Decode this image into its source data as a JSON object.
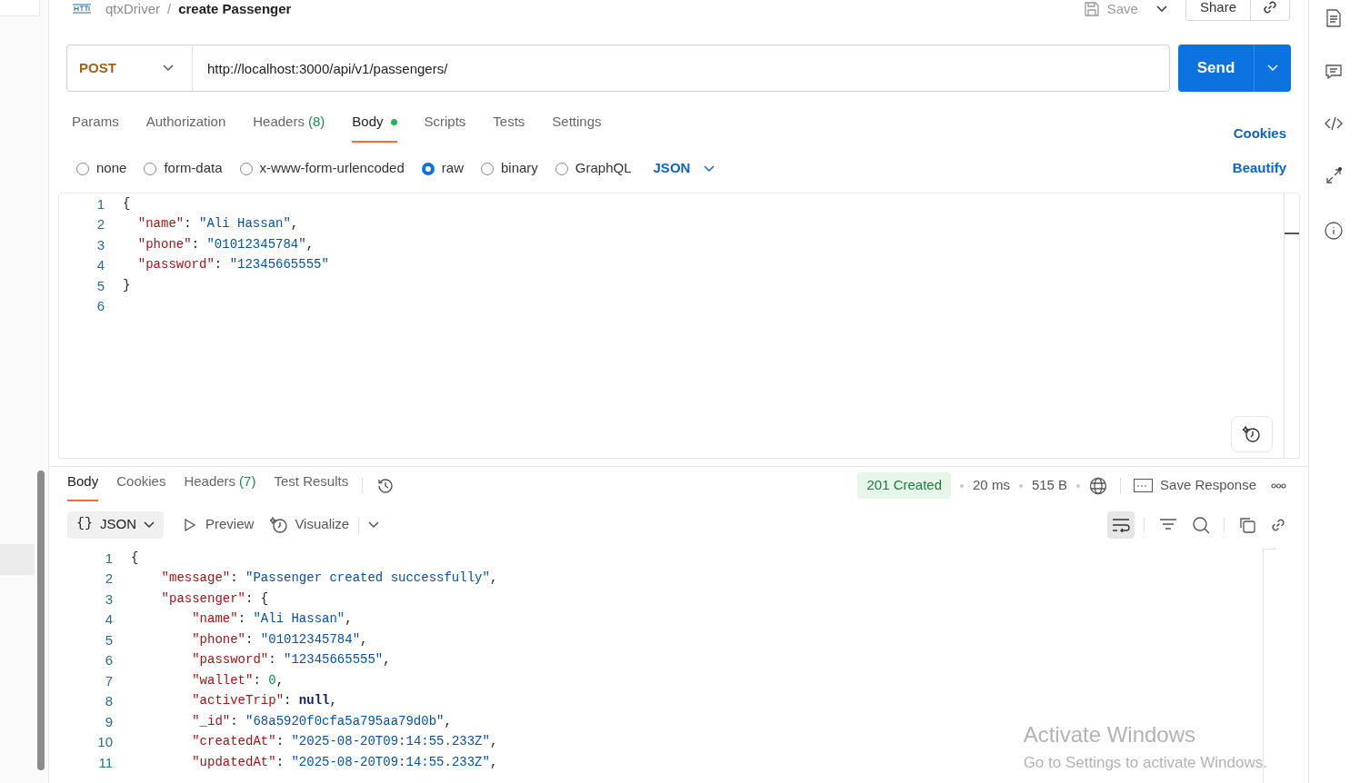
{
  "breadcrumb": {
    "collection": "qtxDriver",
    "separator": "/",
    "request": "create Passenger"
  },
  "header_actions": {
    "save": "Save",
    "share": "Share"
  },
  "request": {
    "method": "POST",
    "url": "http://localhost:3000/api/v1/passengers/",
    "send": "Send"
  },
  "request_tabs": [
    {
      "label": "Params",
      "selected": false,
      "dot": false
    },
    {
      "label": "Authorization",
      "selected": false,
      "dot": false
    },
    {
      "label": "Headers",
      "count": "(8)",
      "selected": false,
      "dot": false
    },
    {
      "label": "Body",
      "selected": true,
      "dot": true
    },
    {
      "label": "Scripts",
      "selected": false,
      "dot": false
    },
    {
      "label": "Tests",
      "selected": false,
      "dot": false
    },
    {
      "label": "Settings",
      "selected": false,
      "dot": false
    }
  ],
  "cookies_link": "Cookies",
  "body_types": [
    {
      "label": "none",
      "selected": false
    },
    {
      "label": "form-data",
      "selected": false
    },
    {
      "label": "x-www-form-urlencoded",
      "selected": false
    },
    {
      "label": "raw",
      "selected": true
    },
    {
      "label": "binary",
      "selected": false
    },
    {
      "label": "GraphQL",
      "selected": false
    }
  ],
  "raw_format": "JSON",
  "beautify": "Beautify",
  "request_body": [
    {
      "number": "1",
      "tokens": [
        {
          "kind": "punct",
          "text": "{"
        }
      ]
    },
    {
      "number": "2",
      "tokens": [
        {
          "kind": "key",
          "text": "  \"name\""
        },
        {
          "kind": "punct",
          "text": ": "
        },
        {
          "kind": "str",
          "text": "\"Ali Hassan\""
        },
        {
          "kind": "punct",
          "text": ","
        }
      ]
    },
    {
      "number": "3",
      "tokens": [
        {
          "kind": "key",
          "text": "  \"phone\""
        },
        {
          "kind": "punct",
          "text": ": "
        },
        {
          "kind": "str",
          "text": "\"01012345784\""
        },
        {
          "kind": "punct",
          "text": ","
        }
      ]
    },
    {
      "number": "4",
      "tokens": [
        {
          "kind": "key",
          "text": "  \"password\""
        },
        {
          "kind": "punct",
          "text": ": "
        },
        {
          "kind": "str",
          "text": "\"12345665555\""
        }
      ]
    },
    {
      "number": "5",
      "tokens": [
        {
          "kind": "punct",
          "text": "}"
        }
      ]
    },
    {
      "number": "6"
    }
  ],
  "response_tabs": [
    {
      "label": "Body",
      "selected": true
    },
    {
      "label": "Cookies",
      "selected": false
    },
    {
      "label": "Headers",
      "count": "(7)",
      "selected": false
    },
    {
      "label": "Test Results",
      "selected": false
    }
  ],
  "response_meta": {
    "status": "201 Created",
    "time": "20 ms",
    "size": "515 B",
    "save_response": "Save Response"
  },
  "response_views": {
    "format_icon": "{}",
    "format": "JSON",
    "preview": "Preview",
    "visualize": "Visualize"
  },
  "response_body": [
    {
      "number": "1",
      "tokens": [
        {
          "kind": "punct",
          "text": "{"
        }
      ]
    },
    {
      "number": "2",
      "tokens": [
        {
          "kind": "key",
          "text": "    \"message\""
        },
        {
          "kind": "punct",
          "text": ": "
        },
        {
          "kind": "str",
          "text": "\"Passenger created successfully\""
        },
        {
          "kind": "punct",
          "text": ","
        }
      ]
    },
    {
      "number": "3",
      "tokens": [
        {
          "kind": "key",
          "text": "    \"passenger\""
        },
        {
          "kind": "punct",
          "text": ": {"
        }
      ]
    },
    {
      "number": "4",
      "tokens": [
        {
          "kind": "key",
          "text": "        \"name\""
        },
        {
          "kind": "punct",
          "text": ": "
        },
        {
          "kind": "str",
          "text": "\"Ali Hassan\""
        },
        {
          "kind": "punct",
          "text": ","
        }
      ]
    },
    {
      "number": "5",
      "tokens": [
        {
          "kind": "key",
          "text": "        \"phone\""
        },
        {
          "kind": "punct",
          "text": ": "
        },
        {
          "kind": "str",
          "text": "\"01012345784\""
        },
        {
          "kind": "punct",
          "text": ","
        }
      ]
    },
    {
      "number": "6",
      "tokens": [
        {
          "kind": "key",
          "text": "        \"password\""
        },
        {
          "kind": "punct",
          "text": ": "
        },
        {
          "kind": "str",
          "text": "\"12345665555\""
        },
        {
          "kind": "punct",
          "text": ","
        }
      ]
    },
    {
      "number": "7",
      "tokens": [
        {
          "kind": "key",
          "text": "        \"wallet\""
        },
        {
          "kind": "punct",
          "text": ": "
        },
        {
          "kind": "num",
          "text": "0"
        },
        {
          "kind": "punct",
          "text": ","
        }
      ]
    },
    {
      "number": "8",
      "tokens": [
        {
          "kind": "key",
          "text": "        \"activeTrip\""
        },
        {
          "kind": "punct",
          "text": ": "
        },
        {
          "kind": "null",
          "text": "null"
        },
        {
          "kind": "punct",
          "text": ","
        }
      ]
    },
    {
      "number": "9",
      "tokens": [
        {
          "kind": "key",
          "text": "        \"_id\""
        },
        {
          "kind": "punct",
          "text": ": "
        },
        {
          "kind": "str",
          "text": "\"68a5920f0cfa5a795aa79d0b\""
        },
        {
          "kind": "punct",
          "text": ","
        }
      ]
    },
    {
      "number": "10",
      "tokens": [
        {
          "kind": "key",
          "text": "        \"createdAt\""
        },
        {
          "kind": "punct",
          "text": ": "
        },
        {
          "kind": "str",
          "text": "\"2025-08-20T09:14:55.233Z\""
        },
        {
          "kind": "punct",
          "text": ","
        }
      ]
    },
    {
      "number": "11",
      "tokens": [
        {
          "kind": "key",
          "text": "        \"updatedAt\""
        },
        {
          "kind": "punct",
          "text": ": "
        },
        {
          "kind": "str",
          "text": "\"2025-08-20T09:14:55.233Z\""
        },
        {
          "kind": "punct",
          "text": ","
        }
      ]
    }
  ],
  "os_notice": {
    "title": "Activate Windows",
    "subtitle": "Go to Settings to activate Windows."
  }
}
